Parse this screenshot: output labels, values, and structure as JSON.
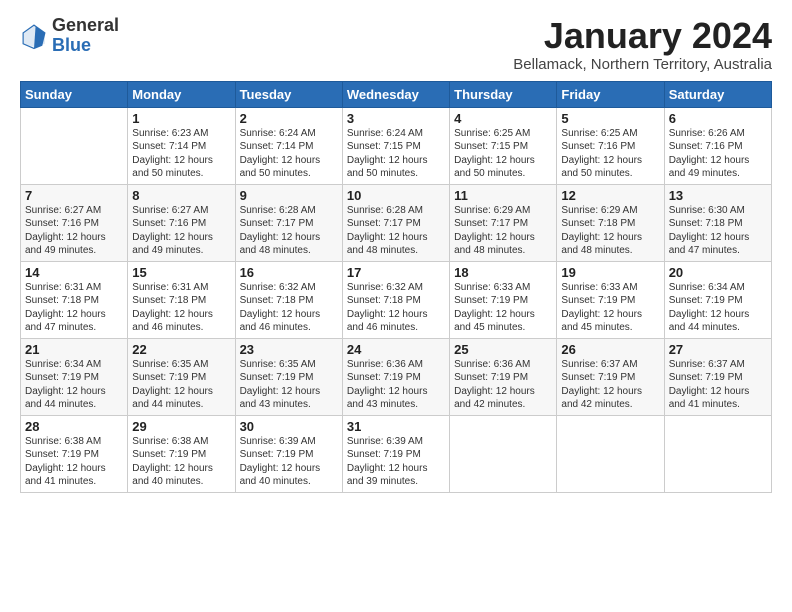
{
  "logo": {
    "general": "General",
    "blue": "Blue"
  },
  "header": {
    "month": "January 2024",
    "location": "Bellamack, Northern Territory, Australia"
  },
  "weekdays": [
    "Sunday",
    "Monday",
    "Tuesday",
    "Wednesday",
    "Thursday",
    "Friday",
    "Saturday"
  ],
  "weeks": [
    [
      {
        "day": "",
        "sunrise": "",
        "sunset": "",
        "daylight": ""
      },
      {
        "day": "1",
        "sunrise": "Sunrise: 6:23 AM",
        "sunset": "Sunset: 7:14 PM",
        "daylight": "Daylight: 12 hours and 50 minutes."
      },
      {
        "day": "2",
        "sunrise": "Sunrise: 6:24 AM",
        "sunset": "Sunset: 7:14 PM",
        "daylight": "Daylight: 12 hours and 50 minutes."
      },
      {
        "day": "3",
        "sunrise": "Sunrise: 6:24 AM",
        "sunset": "Sunset: 7:15 PM",
        "daylight": "Daylight: 12 hours and 50 minutes."
      },
      {
        "day": "4",
        "sunrise": "Sunrise: 6:25 AM",
        "sunset": "Sunset: 7:15 PM",
        "daylight": "Daylight: 12 hours and 50 minutes."
      },
      {
        "day": "5",
        "sunrise": "Sunrise: 6:25 AM",
        "sunset": "Sunset: 7:16 PM",
        "daylight": "Daylight: 12 hours and 50 minutes."
      },
      {
        "day": "6",
        "sunrise": "Sunrise: 6:26 AM",
        "sunset": "Sunset: 7:16 PM",
        "daylight": "Daylight: 12 hours and 49 minutes."
      }
    ],
    [
      {
        "day": "7",
        "sunrise": "Sunrise: 6:27 AM",
        "sunset": "Sunset: 7:16 PM",
        "daylight": "Daylight: 12 hours and 49 minutes."
      },
      {
        "day": "8",
        "sunrise": "Sunrise: 6:27 AM",
        "sunset": "Sunset: 7:16 PM",
        "daylight": "Daylight: 12 hours and 49 minutes."
      },
      {
        "day": "9",
        "sunrise": "Sunrise: 6:28 AM",
        "sunset": "Sunset: 7:17 PM",
        "daylight": "Daylight: 12 hours and 48 minutes."
      },
      {
        "day": "10",
        "sunrise": "Sunrise: 6:28 AM",
        "sunset": "Sunset: 7:17 PM",
        "daylight": "Daylight: 12 hours and 48 minutes."
      },
      {
        "day": "11",
        "sunrise": "Sunrise: 6:29 AM",
        "sunset": "Sunset: 7:17 PM",
        "daylight": "Daylight: 12 hours and 48 minutes."
      },
      {
        "day": "12",
        "sunrise": "Sunrise: 6:29 AM",
        "sunset": "Sunset: 7:18 PM",
        "daylight": "Daylight: 12 hours and 48 minutes."
      },
      {
        "day": "13",
        "sunrise": "Sunrise: 6:30 AM",
        "sunset": "Sunset: 7:18 PM",
        "daylight": "Daylight: 12 hours and 47 minutes."
      }
    ],
    [
      {
        "day": "14",
        "sunrise": "Sunrise: 6:31 AM",
        "sunset": "Sunset: 7:18 PM",
        "daylight": "Daylight: 12 hours and 47 minutes."
      },
      {
        "day": "15",
        "sunrise": "Sunrise: 6:31 AM",
        "sunset": "Sunset: 7:18 PM",
        "daylight": "Daylight: 12 hours and 46 minutes."
      },
      {
        "day": "16",
        "sunrise": "Sunrise: 6:32 AM",
        "sunset": "Sunset: 7:18 PM",
        "daylight": "Daylight: 12 hours and 46 minutes."
      },
      {
        "day": "17",
        "sunrise": "Sunrise: 6:32 AM",
        "sunset": "Sunset: 7:18 PM",
        "daylight": "Daylight: 12 hours and 46 minutes."
      },
      {
        "day": "18",
        "sunrise": "Sunrise: 6:33 AM",
        "sunset": "Sunset: 7:19 PM",
        "daylight": "Daylight: 12 hours and 45 minutes."
      },
      {
        "day": "19",
        "sunrise": "Sunrise: 6:33 AM",
        "sunset": "Sunset: 7:19 PM",
        "daylight": "Daylight: 12 hours and 45 minutes."
      },
      {
        "day": "20",
        "sunrise": "Sunrise: 6:34 AM",
        "sunset": "Sunset: 7:19 PM",
        "daylight": "Daylight: 12 hours and 44 minutes."
      }
    ],
    [
      {
        "day": "21",
        "sunrise": "Sunrise: 6:34 AM",
        "sunset": "Sunset: 7:19 PM",
        "daylight": "Daylight: 12 hours and 44 minutes."
      },
      {
        "day": "22",
        "sunrise": "Sunrise: 6:35 AM",
        "sunset": "Sunset: 7:19 PM",
        "daylight": "Daylight: 12 hours and 44 minutes."
      },
      {
        "day": "23",
        "sunrise": "Sunrise: 6:35 AM",
        "sunset": "Sunset: 7:19 PM",
        "daylight": "Daylight: 12 hours and 43 minutes."
      },
      {
        "day": "24",
        "sunrise": "Sunrise: 6:36 AM",
        "sunset": "Sunset: 7:19 PM",
        "daylight": "Daylight: 12 hours and 43 minutes."
      },
      {
        "day": "25",
        "sunrise": "Sunrise: 6:36 AM",
        "sunset": "Sunset: 7:19 PM",
        "daylight": "Daylight: 12 hours and 42 minutes."
      },
      {
        "day": "26",
        "sunrise": "Sunrise: 6:37 AM",
        "sunset": "Sunset: 7:19 PM",
        "daylight": "Daylight: 12 hours and 42 minutes."
      },
      {
        "day": "27",
        "sunrise": "Sunrise: 6:37 AM",
        "sunset": "Sunset: 7:19 PM",
        "daylight": "Daylight: 12 hours and 41 minutes."
      }
    ],
    [
      {
        "day": "28",
        "sunrise": "Sunrise: 6:38 AM",
        "sunset": "Sunset: 7:19 PM",
        "daylight": "Daylight: 12 hours and 41 minutes."
      },
      {
        "day": "29",
        "sunrise": "Sunrise: 6:38 AM",
        "sunset": "Sunset: 7:19 PM",
        "daylight": "Daylight: 12 hours and 40 minutes."
      },
      {
        "day": "30",
        "sunrise": "Sunrise: 6:39 AM",
        "sunset": "Sunset: 7:19 PM",
        "daylight": "Daylight: 12 hours and 40 minutes."
      },
      {
        "day": "31",
        "sunrise": "Sunrise: 6:39 AM",
        "sunset": "Sunset: 7:19 PM",
        "daylight": "Daylight: 12 hours and 39 minutes."
      },
      {
        "day": "",
        "sunrise": "",
        "sunset": "",
        "daylight": ""
      },
      {
        "day": "",
        "sunrise": "",
        "sunset": "",
        "daylight": ""
      },
      {
        "day": "",
        "sunrise": "",
        "sunset": "",
        "daylight": ""
      }
    ]
  ]
}
